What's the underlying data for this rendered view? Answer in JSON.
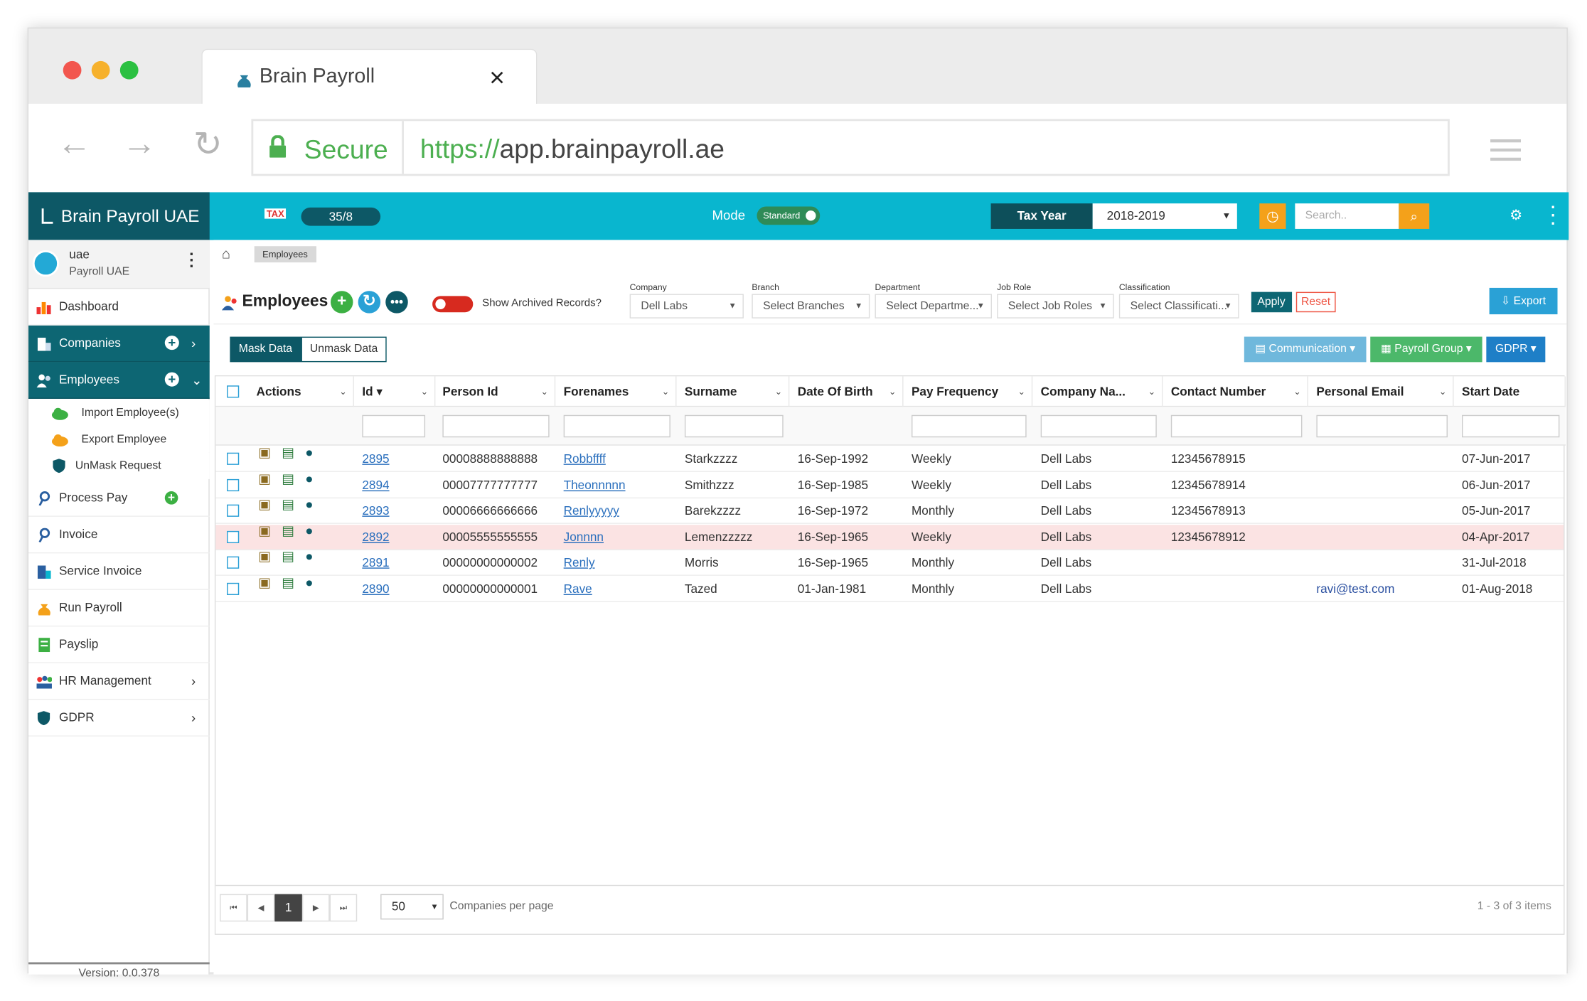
{
  "browser": {
    "tab_title": "Brain Payroll",
    "secure_label": "Secure",
    "url_scheme": "https://",
    "url_host": "app.brainpayroll.ae"
  },
  "header": {
    "brand": "Brain Payroll UAE",
    "tax_logo": "TAX",
    "counter": "35/8",
    "mode_label": "Mode",
    "mode_value": "Standard",
    "tax_year_label": "Tax Year",
    "tax_year_value": "2018-2019",
    "search_placeholder": "Search.."
  },
  "user": {
    "name": "uae",
    "company": "Payroll UAE"
  },
  "sidebar": {
    "items": [
      "Dashboard",
      "Companies",
      "Employees",
      "Process Pay",
      "Invoice",
      "Service Invoice",
      "Run Payroll",
      "Payslip",
      "HR Management",
      "GDPR"
    ],
    "employee_sub": [
      "Import Employee(s)",
      "Export Employee",
      "UnMask Request"
    ],
    "version": "Version: 0.0.378"
  },
  "breadcrumb": "Employees",
  "page": {
    "title": "Employees",
    "archived_label": "Show Archived Records?",
    "apply": "Apply",
    "reset": "Reset",
    "export": "Export",
    "mask": "Mask Data",
    "unmask": "Unmask Data",
    "communication": "Communication",
    "payroll_group": "Payroll Group",
    "gdpr": "GDPR"
  },
  "filters": [
    {
      "label": "Company",
      "value": "Dell Labs"
    },
    {
      "label": "Branch",
      "value": "Select Branches"
    },
    {
      "label": "Department",
      "value": "Select Departme..."
    },
    {
      "label": "Job Role",
      "value": "Select Job Roles"
    },
    {
      "label": "Classification",
      "value": "Select Classificati..."
    }
  ],
  "table": {
    "columns": [
      "Actions",
      "Id",
      "Person Id",
      "Forenames",
      "Surname",
      "Date Of Birth",
      "Pay Frequency",
      "Company Na...",
      "Contact Number",
      "Personal Email",
      "Start Date"
    ],
    "rows": [
      {
        "id": "2895",
        "person_id": "00008888888888",
        "forenames": "Robbffff",
        "surname": "Starkzzzz",
        "dob": "16-Sep-1992",
        "pay": "Weekly",
        "company": "Dell Labs",
        "contact": "12345678915",
        "email": "",
        "start": "07-Jun-2017"
      },
      {
        "id": "2894",
        "person_id": "00007777777777",
        "forenames": "Theonnnnn",
        "surname": "Smithzzz",
        "dob": "16-Sep-1985",
        "pay": "Weekly",
        "company": "Dell Labs",
        "contact": "12345678914",
        "email": "",
        "start": "06-Jun-2017"
      },
      {
        "id": "2893",
        "person_id": "00006666666666",
        "forenames": "Renlyyyyy",
        "surname": "Barekzzzz",
        "dob": "16-Sep-1972",
        "pay": "Monthly",
        "company": "Dell Labs",
        "contact": "12345678913",
        "email": "",
        "start": "05-Jun-2017"
      },
      {
        "id": "2892",
        "person_id": "00005555555555",
        "forenames": "Jonnnn",
        "surname": "Lemenzzzzz",
        "dob": "16-Sep-1965",
        "pay": "Weekly",
        "company": "Dell Labs",
        "contact": "12345678912",
        "email": "",
        "start": "04-Apr-2017"
      },
      {
        "id": "2891",
        "person_id": "00000000000002",
        "forenames": "Renly",
        "surname": "Morris",
        "dob": "16-Sep-1965",
        "pay": "Monthly",
        "company": "Dell Labs",
        "contact": "",
        "email": "",
        "start": "31-Jul-2018"
      },
      {
        "id": "2890",
        "person_id": "00000000000001",
        "forenames": "Rave",
        "surname": "Tazed",
        "dob": "01-Jan-1981",
        "pay": "Monthly",
        "company": "Dell Labs",
        "contact": "",
        "email": "ravi@test.com",
        "start": "01-Aug-2018"
      }
    ]
  },
  "pager": {
    "current": "1",
    "page_size": "50",
    "per_page_label": "Companies per page",
    "info": "1 - 3 of 3 items"
  },
  "colors": {
    "teal": "#09b6cf",
    "dark_teal": "#0d5866",
    "orange": "#f4a11a",
    "green": "#3cb043",
    "red": "#d72a1f"
  }
}
